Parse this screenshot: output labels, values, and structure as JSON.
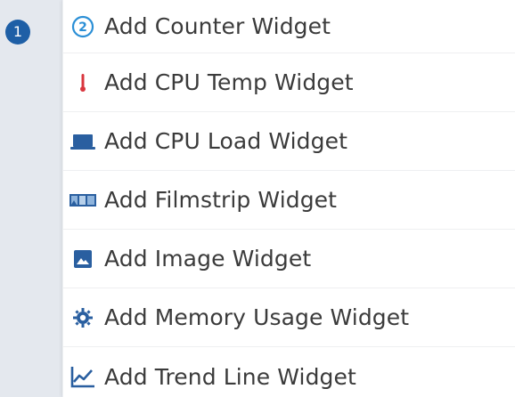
{
  "step_badge": "1",
  "menu": {
    "items": [
      {
        "label": "Add Counter Widget",
        "icon": "counter-icon"
      },
      {
        "label": "Add CPU Temp Widget",
        "icon": "thermometer-icon"
      },
      {
        "label": "Add CPU Load Widget",
        "icon": "laptop-icon"
      },
      {
        "label": "Add Filmstrip Widget",
        "icon": "filmstrip-icon"
      },
      {
        "label": "Add Image Widget",
        "icon": "image-icon"
      },
      {
        "label": "Add Memory Usage Widget",
        "icon": "memory-chip-icon"
      },
      {
        "label": "Add Trend Line Widget",
        "icon": "trend-line-icon"
      }
    ]
  },
  "colors": {
    "badge": "#1e5fa6",
    "icon_blue": "#2a5fa0",
    "icon_red": "#d9363e",
    "text": "#3b3b3b"
  }
}
